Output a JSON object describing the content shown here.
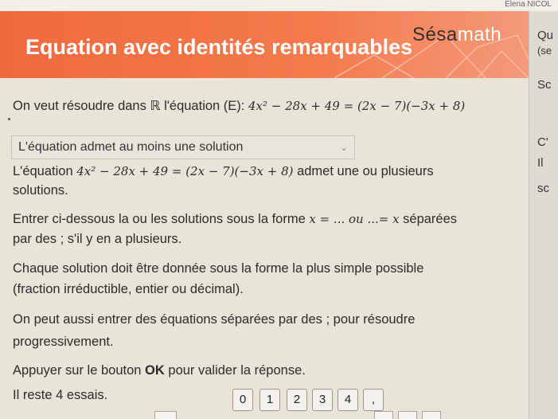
{
  "top_user": "Elena NICOL",
  "header": {
    "title": "Equation avec identités remarquables",
    "brand_prefix": "Sésa",
    "brand_suffix": "math"
  },
  "side": {
    "items": [
      "Qu",
      "(se",
      "Sc",
      "C'",
      "Il",
      "sc"
    ]
  },
  "content": {
    "intro": "On veut résoudre dans ℝ l'équation (E):",
    "equation": "4x² − 28x + 49 = (2x − 7)(−3x + 8)",
    "select_value": "L'équation admet au moins une solution",
    "statement_prefix": "L'équation",
    "statement_suffix": "admet une ou plusieurs",
    "statement_line2": "solutions.",
    "instr1_a": "Entrer ci-dessous la ou les solutions sous la forme",
    "instr1_b": "x = ... ou ...= x",
    "instr1_c": "séparées",
    "instr1_line2": "par des ; s'il y en a plusieurs.",
    "instr2_line1": "Chaque solution doit être donnée sous la forme la plus simple possible",
    "instr2_line2": "(fraction irréductible, entier ou décimal).",
    "instr3_line1": "On peut aussi entrer des équations séparées par des ; pour résoudre",
    "instr3_line2": "progressivement.",
    "instr4_a": "Appuyer sur le bouton",
    "instr4_ok": "OK",
    "instr4_b": "pour valider la réponse.",
    "tries": "Il reste 4 essais."
  },
  "keypad": [
    "0",
    "1",
    "2",
    "3",
    "4",
    ","
  ]
}
